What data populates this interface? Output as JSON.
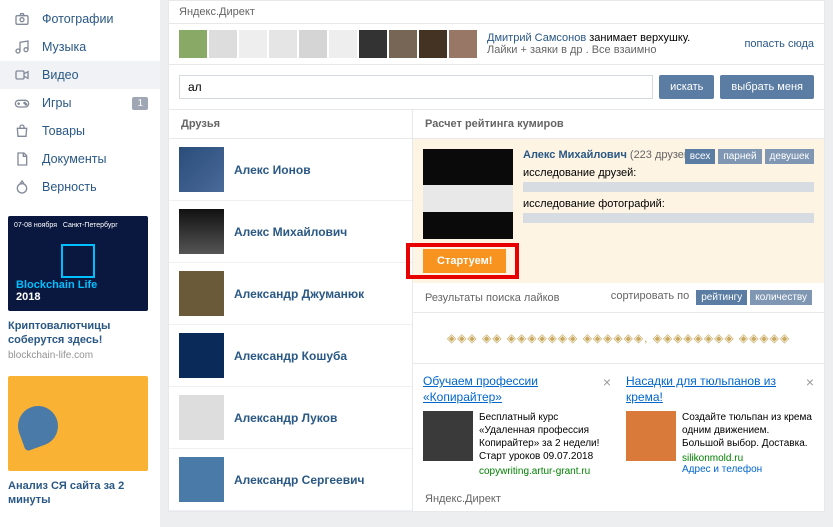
{
  "sidebar": {
    "items": [
      {
        "label": "Фотографии",
        "icon": "camera"
      },
      {
        "label": "Музыка",
        "icon": "music"
      },
      {
        "label": "Видео",
        "icon": "video"
      },
      {
        "label": "Игры",
        "icon": "gamepad",
        "badge": "1"
      },
      {
        "label": "Товары",
        "icon": "bag"
      },
      {
        "label": "Документы",
        "icon": "doc"
      },
      {
        "label": "Верность",
        "icon": "ring"
      }
    ],
    "promo1": {
      "title": "Криптовалютчицы соберутся здесь!",
      "domain": "blockchain-life.com",
      "year": "2018",
      "brand": "Blockchain Life"
    },
    "promo2": {
      "title": "Анализ СЯ сайта за 2 минуты"
    }
  },
  "topbar": {
    "label": "Яндекс.Директ"
  },
  "feed": {
    "user": "Дмитрий Самсонов",
    "action": "занимает верхушку.",
    "desc": "Лайки + заяки в др . Все взаимно",
    "link": "попасть сюда"
  },
  "search": {
    "value": "ал",
    "search_btn": "искать",
    "select_btn": "выбрать меня"
  },
  "friends": {
    "header": "Друзья",
    "list": [
      {
        "name": "Алекс Ионов"
      },
      {
        "name": "Алекс Михайлович"
      },
      {
        "name": "Александр Джуманюк"
      },
      {
        "name": "Александр Кошуба"
      },
      {
        "name": "Александр Луков"
      },
      {
        "name": "Александр Сергеевич"
      }
    ]
  },
  "rating": {
    "header": "Расчет рейтинга кумиров",
    "name": "Алекс Михайлович",
    "friends_count": "(223 друзей)",
    "line1": "исследование друзей:",
    "line2": "исследование фотографий:",
    "tabs": [
      "всех",
      "парней",
      "девушек"
    ],
    "start_btn": "Стартуем!"
  },
  "results": {
    "header": "Результаты поиска лайков",
    "sort_label": "сортировать по",
    "sort_tabs": [
      "рейтингу",
      "количеству"
    ],
    "diamonds": "◈◈◈ ◈◈ ◈◈◈◈◈◈◈ ◈◈◈◈◈◈, ◈◈◈◈◈◈◈◈ ◈◈◈◈◈"
  },
  "ads": [
    {
      "title": "Обучаем профессии «Копирайтер»",
      "text": "Бесплатный курс «Удаленная профессия Копирайтер» за 2 недели! Старт уроков 09.07.2018",
      "domain": "copywriting.artur-grant.ru"
    },
    {
      "title": "Насадки для тюльпанов из крема!",
      "text": "Создайте тюльпан из крема одним движением. Большой выбор. Доставка.",
      "domain": "silikonmold.ru",
      "contact": "Адрес и телефон"
    }
  ],
  "footer": {
    "label": "Яндекс.Директ"
  }
}
